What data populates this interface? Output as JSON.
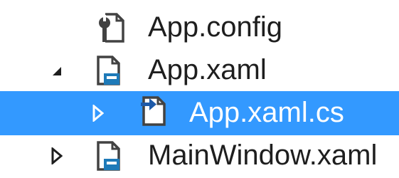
{
  "solution_explorer": {
    "items": [
      {
        "label": "App.config",
        "icon": "config-file-icon",
        "expander": "none",
        "selected": false
      },
      {
        "label": "App.xaml",
        "icon": "xaml-file-icon",
        "expander": "expanded",
        "selected": false
      },
      {
        "label": "App.xaml.cs",
        "icon": "csharp-code-behind-file-icon",
        "expander": "collapsed",
        "selected": true
      },
      {
        "label": "MainWindow.xaml",
        "icon": "xaml-file-icon",
        "expander": "collapsed",
        "selected": false
      }
    ]
  },
  "colors": {
    "selection_background": "#3399ff",
    "text": "#1e1e1e",
    "selected_text": "#ffffff",
    "icon_stroke": "#424242",
    "xaml_accent": "#1e7ab8",
    "csharp_arrow": "#1e5aa8"
  }
}
